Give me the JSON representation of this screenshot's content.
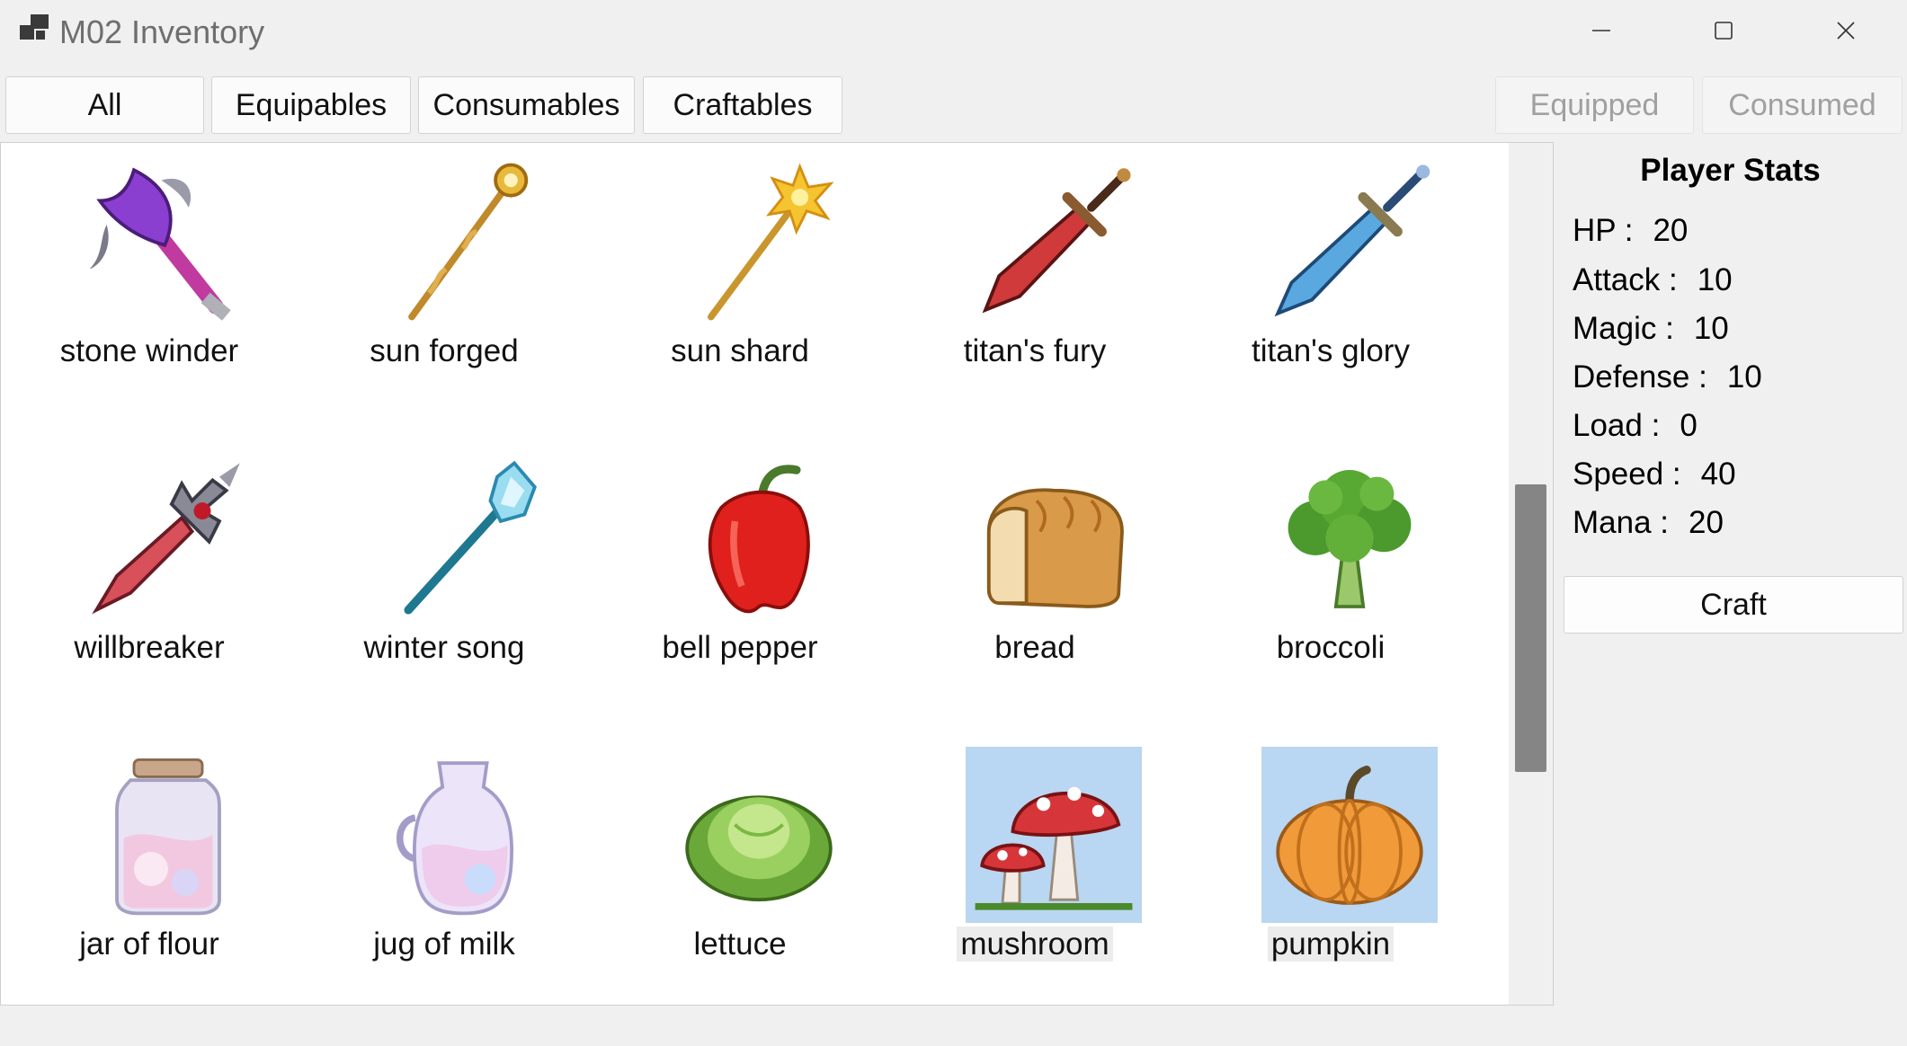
{
  "window": {
    "title": "M02 Inventory"
  },
  "tabs": [
    "All",
    "Equipables",
    "Consumables",
    "Craftables"
  ],
  "actions": {
    "equipped": "Equipped",
    "consumed": "Consumed",
    "craft": "Craft"
  },
  "items": [
    {
      "name": "stone winder",
      "icon": "battle-axe-icon"
    },
    {
      "name": "sun forged",
      "icon": "golden-staff-icon"
    },
    {
      "name": "sun shard",
      "icon": "sun-scepter-icon"
    },
    {
      "name": "titan's fury",
      "icon": "red-sword-icon"
    },
    {
      "name": "titan's glory",
      "icon": "blue-sword-icon"
    },
    {
      "name": "willbreaker",
      "icon": "crimson-dagger-icon"
    },
    {
      "name": "winter song",
      "icon": "ice-staff-icon"
    },
    {
      "name": "bell pepper",
      "icon": "bell-pepper-icon"
    },
    {
      "name": "bread",
      "icon": "bread-icon"
    },
    {
      "name": "broccoli",
      "icon": "broccoli-icon"
    },
    {
      "name": "jar of flour",
      "icon": "flour-jar-icon"
    },
    {
      "name": "jug of milk",
      "icon": "milk-jug-icon"
    },
    {
      "name": "lettuce",
      "icon": "lettuce-icon"
    },
    {
      "name": "mushroom",
      "icon": "mushroom-icon",
      "selected": true
    },
    {
      "name": "pumpkin",
      "icon": "pumpkin-icon",
      "selected": true
    }
  ],
  "stats": {
    "title": "Player Stats",
    "rows": [
      {
        "label": "HP :",
        "value": "20"
      },
      {
        "label": "Attack :",
        "value": "10"
      },
      {
        "label": "Magic :",
        "value": "10"
      },
      {
        "label": "Defense :",
        "value": "10"
      },
      {
        "label": "Load :",
        "value": "0"
      },
      {
        "label": "Speed :",
        "value": "40"
      },
      {
        "label": "Mana :",
        "value": "20"
      }
    ]
  },
  "colors": {
    "selection": "#b9d6f2",
    "scroll_thumb": "#858585"
  }
}
